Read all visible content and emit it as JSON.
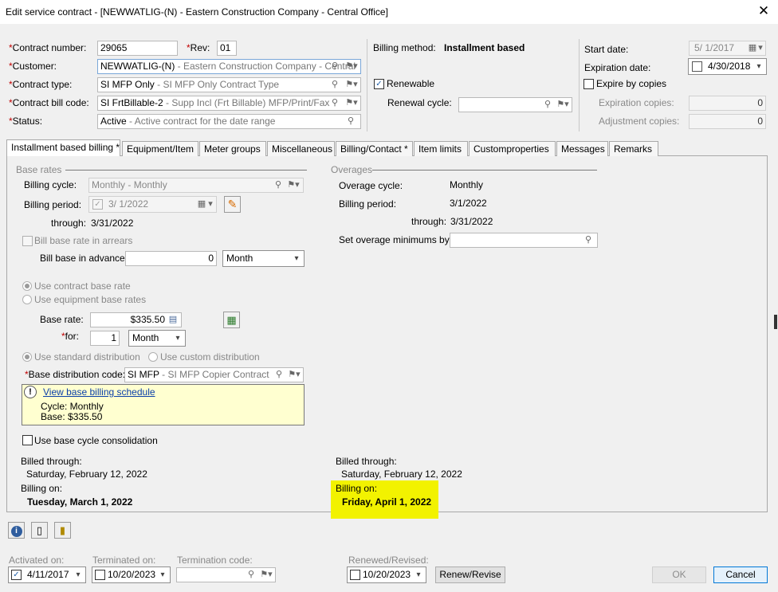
{
  "window": {
    "title": "Edit service contract - [NEWWATLIG-(N) - Eastern Construction Company - Central Office]"
  },
  "header": {
    "contract_number_label": "Contract number:",
    "contract_number": "29065",
    "rev_label": "Rev:",
    "rev": "01",
    "customer_label": "Customer:",
    "customer_code": "NEWWATLIG-(N)",
    "customer_desc": " - Eastern Construction Company - Central",
    "contract_type_label": "Contract type:",
    "contract_type_code": "SI MFP Only",
    "contract_type_desc": " - SI MFP Only Contract Type",
    "bill_code_label": "Contract bill code:",
    "bill_code_code": "SI FrtBillable-2",
    "bill_code_desc": " - Supp Incl (Frt Billable) MFP/Print/Fax",
    "status_label": "Status:",
    "status_code": "Active",
    "status_desc": " - Active contract for the date range",
    "billing_method_label": "Billing method:",
    "billing_method": "Installment based",
    "renewable_label": "Renewable",
    "renewal_cycle_label": "Renewal cycle:",
    "start_date_label": "Start date:",
    "start_date": "5/  1/2017",
    "expiration_date_label": "Expiration date:",
    "expiration_date": "4/30/2018",
    "expire_by_copies_label": "Expire by copies",
    "expiration_copies_label": "Expiration copies:",
    "expiration_copies": "0",
    "adjustment_copies_label": "Adjustment copies:",
    "adjustment_copies": "0"
  },
  "tabs": [
    {
      "label": "Installment based billing *"
    },
    {
      "label": "Equipment/Item"
    },
    {
      "label": "Meter groups"
    },
    {
      "label": "Miscellaneous"
    },
    {
      "label": "Billing/Contact *"
    },
    {
      "label": "Item limits"
    },
    {
      "label": "Customproperties"
    },
    {
      "label": "Messages"
    },
    {
      "label": "Remarks"
    }
  ],
  "base": {
    "section_label": "Base rates",
    "billing_cycle_label": "Billing cycle:",
    "billing_cycle_code": "Monthly",
    "billing_cycle_desc": " - Monthly",
    "billing_period_label": "Billing period:",
    "billing_period": "3/  1/2022",
    "through_label": "through:",
    "through": "3/31/2022",
    "bill_arrears_label": "Bill base rate in arrears",
    "bill_advance_label": "Bill base in advance:",
    "bill_advance_value": "0",
    "bill_advance_unit": "Month",
    "use_contract_rate_label": "Use contract base rate",
    "use_equipment_rates_label": "Use equipment base rates",
    "base_rate_label": "Base rate:",
    "base_rate": "$335.50",
    "for_label": "for:",
    "for_value": "1",
    "for_unit": "Month",
    "std_dist_label": "Use standard distribution",
    "custom_dist_label": "Use custom distribution",
    "dist_code_label": "Base distribution code:",
    "dist_code": "SI MFP",
    "dist_desc": " - SI MFP Copier Contract",
    "schedule_link": "View base billing schedule",
    "schedule_cycle": "Cycle: Monthly",
    "schedule_base": "Base: $335.50",
    "consolidation_label": "Use base cycle consolidation",
    "billed_through_label": "Billed through:",
    "billed_through": "Saturday, February 12, 2022",
    "billing_on_label": "Billing on:",
    "billing_on": "Tuesday, March 1, 2022"
  },
  "overages": {
    "section_label": "Overages",
    "cycle_label": "Overage cycle:",
    "cycle": "Monthly",
    "billing_period_label": "Billing period:",
    "billing_period": "3/1/2022",
    "through_label": "through:",
    "through": "3/31/2022",
    "minimums_label": "Set overage minimums by:",
    "billed_through_label": "Billed through:",
    "billed_through": "Saturday, February 12, 2022",
    "billing_on_label": "Billing on:",
    "billing_on": "Friday, April 1, 2022",
    "highlight_color": "#f2f200"
  },
  "footer": {
    "activated_label": "Activated on:",
    "activated": "4/11/2017",
    "terminated_label": "Terminated on:",
    "terminated": "10/20/2023",
    "term_code_label": "Termination code:",
    "renewed_label": "Renewed/Revised:",
    "renewed": "10/20/2023",
    "renew_button": "Renew/Revise",
    "ok_button": "OK",
    "cancel_button": "Cancel"
  }
}
